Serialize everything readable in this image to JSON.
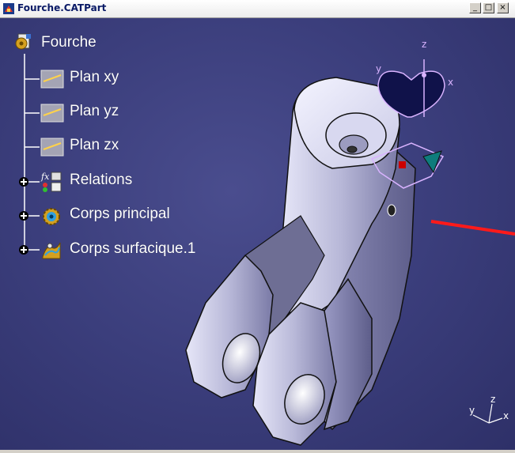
{
  "window": {
    "title": "Fourche.CATPart",
    "controls": {
      "minimize": "_",
      "maximize": "□",
      "close": "×"
    }
  },
  "tree": {
    "root": {
      "label": "Fourche",
      "icon": "part-icon"
    },
    "children": [
      {
        "label": "Plan xy",
        "icon": "plane-icon",
        "expander": false
      },
      {
        "label": "Plan yz",
        "icon": "plane-icon",
        "expander": false
      },
      {
        "label": "Plan zx",
        "icon": "plane-icon",
        "expander": false
      },
      {
        "label": "Relations",
        "icon": "relations-icon",
        "expander": true
      },
      {
        "label": "Corps principal",
        "icon": "gear-body-icon",
        "expander": true
      },
      {
        "label": "Corps surfacique.1",
        "icon": "surface-body-icon",
        "expander": true
      }
    ]
  },
  "compass": {
    "x": "x",
    "y": "y",
    "z": "z"
  },
  "axis_triad": {
    "x": "x",
    "y": "y",
    "z": "z"
  },
  "colors": {
    "background": "#3b3e7c",
    "tree_lines": "#ffffff",
    "compass": "#d9b3ff",
    "compass_fill": "#10124a",
    "axis_line": "#ff1a1a"
  }
}
